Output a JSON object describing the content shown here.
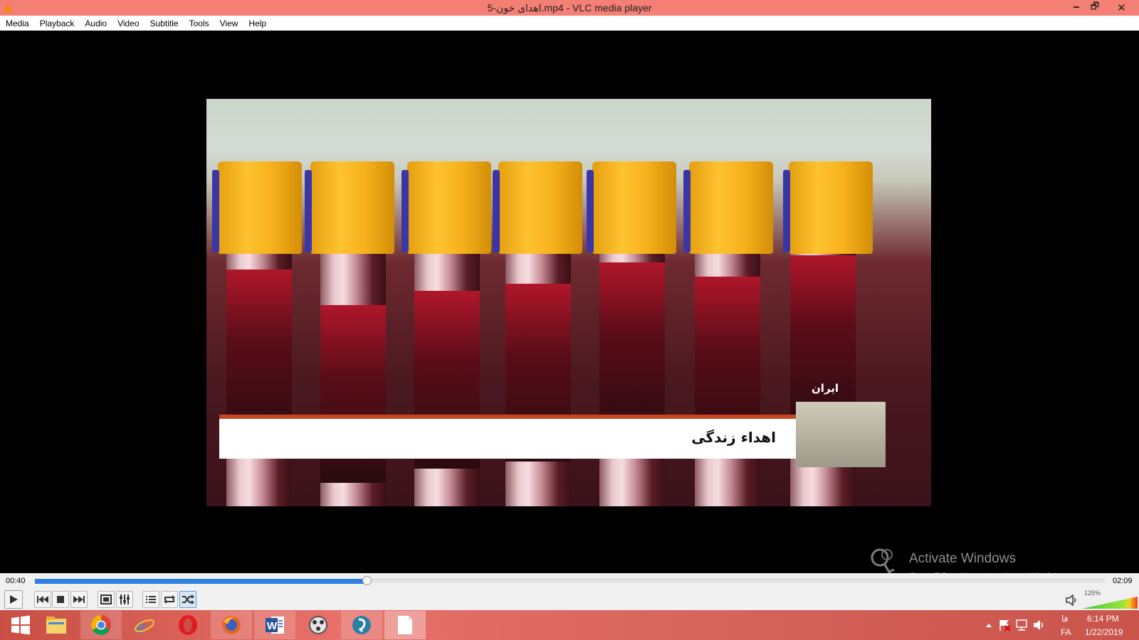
{
  "window": {
    "title": "5-اهدای خون.mp4 - VLC media player",
    "min_glyph": "🗕",
    "max_glyph": "🗗",
    "close_glyph": "✕"
  },
  "menu": {
    "items": [
      "Media",
      "Playback",
      "Audio",
      "Video",
      "Subtitle",
      "Tools",
      "View",
      "Help"
    ]
  },
  "video": {
    "caption": "اهداء زندگی",
    "channel_logo": "ایران"
  },
  "watermark": {
    "line1": "Activate Windows",
    "line2": "Go to PC settings to activate Windows."
  },
  "playback": {
    "current_time": "00:40",
    "total_time": "02:09",
    "progress_fraction": 0.31,
    "volume_percent_label": "125%",
    "accent_color": "#2e7fe2"
  },
  "controls": [
    {
      "name": "play-icon"
    },
    {
      "name": "previous-icon"
    },
    {
      "name": "stop-icon"
    },
    {
      "name": "next-icon"
    },
    {
      "name": "fullscreen-icon"
    },
    {
      "name": "extended-settings-icon"
    },
    {
      "name": "playlist-icon"
    },
    {
      "name": "loop-icon"
    },
    {
      "name": "shuffle-icon"
    }
  ],
  "taskbar": {
    "apps": [
      "start-icon",
      "file-explorer-icon",
      "chrome-icon",
      "internet-explorer-icon",
      "opera-icon",
      "firefox-icon",
      "word-icon",
      "media-player-icon",
      "messenger-icon",
      "notepad-icon"
    ],
    "lang_primary": "فا",
    "lang_secondary": "FA",
    "clock_time": "6:14 PM",
    "clock_date": "1/22/2019"
  }
}
